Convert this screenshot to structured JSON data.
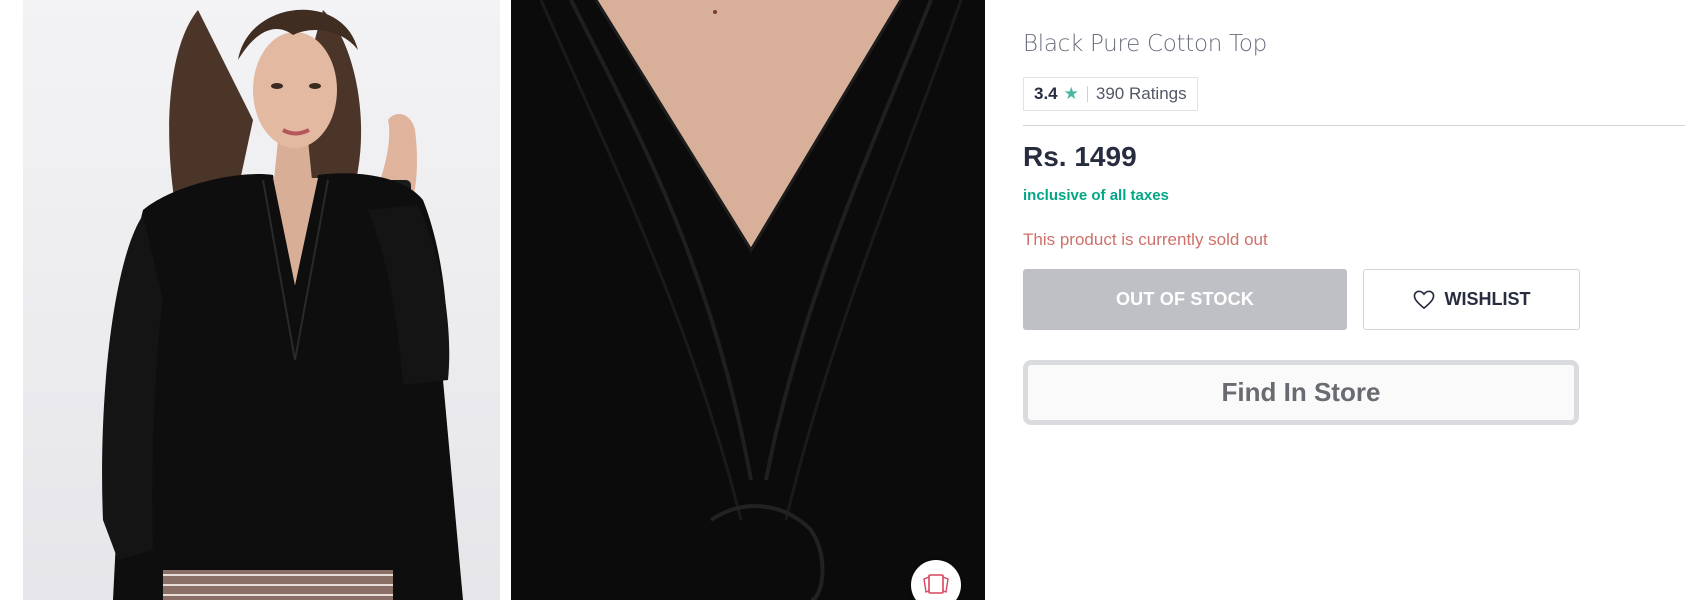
{
  "product": {
    "title": "Black Pure Cotton Top",
    "rating": {
      "value": "3.4",
      "star_icon": "★",
      "count_label": "390 Ratings",
      "star_color": "#48b9a4"
    },
    "price": "Rs. 1499",
    "tax_note": "inclusive of all taxes",
    "stock_message": "This product is currently sold out"
  },
  "actions": {
    "out_of_stock_label": "OUT OF STOCK",
    "wishlist_label": "WISHLIST",
    "find_in_store_label": "Find In Store"
  },
  "gallery": {
    "images": [
      {
        "name": "product-image-front",
        "icon": "model-photo"
      },
      {
        "name": "product-image-detail",
        "icon": "fabric-closeup-photo"
      }
    ],
    "similar_button_icon": "view-similar-icon"
  },
  "colors": {
    "tax_green": "#03a685",
    "sold_out_red": "#d0706a",
    "oos_grey": "#bfc0c6",
    "text_dark": "#282c3f"
  }
}
